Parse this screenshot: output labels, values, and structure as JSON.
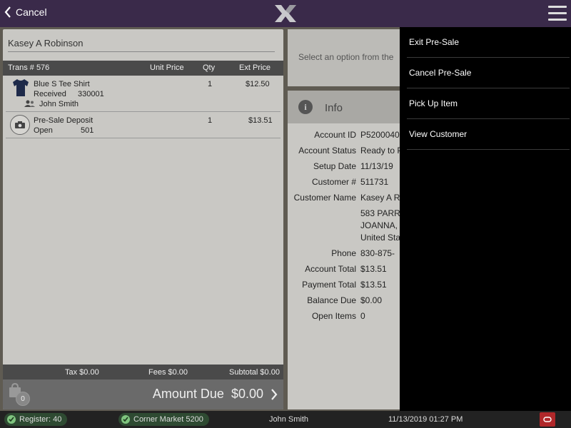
{
  "header": {
    "cancel_label": "Cancel"
  },
  "customer": {
    "name": "Kasey A Robinson"
  },
  "transaction": {
    "trans_label": "Trans # 576",
    "col_unit_price": "Unit Price",
    "col_qty": "Qty",
    "col_ext_price": "Ext Price",
    "items": [
      {
        "name": "Blue S Tee Shirt",
        "status": "Received",
        "code": "330001",
        "assignee": "John Smith",
        "qty": "1",
        "ext_price": "$12.50",
        "icon": "tshirt-icon"
      },
      {
        "name": "Pre-Sale Deposit",
        "status": "Open",
        "code": "501",
        "qty": "1",
        "ext_price": "$13.51",
        "icon": "camera-icon"
      }
    ],
    "tax": "Tax $0.00",
    "fees": "Fees $0.00",
    "subtotal": "Subtotal $0.00",
    "bag_count": "0",
    "amount_due_label": "Amount Due",
    "amount_due_value": "$0.00"
  },
  "prompt": {
    "text": "Select an option from the"
  },
  "info": {
    "title": "Info",
    "rows": [
      {
        "label": "Account ID",
        "value": "P5200040"
      },
      {
        "label": "Account Status",
        "value": "Ready to P"
      },
      {
        "label": "Setup Date",
        "value": "11/13/19"
      },
      {
        "label": "Customer #",
        "value": "511731"
      },
      {
        "label": "Customer Name",
        "value": "Kasey A R"
      },
      {
        "label": "",
        "value": "583 PARR"
      },
      {
        "label": "",
        "value": "JOANNA,"
      },
      {
        "label": "",
        "value": "United Sta"
      },
      {
        "label": "Phone",
        "value": "830-875-"
      },
      {
        "label": "Account Total",
        "value": "$13.51"
      },
      {
        "label": "Payment Total",
        "value": "$13.51"
      },
      {
        "label": "Balance Due",
        "value": "$0.00"
      },
      {
        "label": "Open Items",
        "value": "0"
      }
    ]
  },
  "menu": {
    "items": [
      {
        "label": "Exit Pre-Sale"
      },
      {
        "label": "Cancel Pre-Sale"
      },
      {
        "label": "Pick Up Item"
      },
      {
        "label": "View Customer"
      }
    ]
  },
  "status": {
    "register": "Register: 40",
    "store": "Corner Market 5200",
    "user": "John Smith",
    "datetime": "11/13/2019 01:27 PM"
  },
  "colors": {
    "topbar": "#3a2a4a",
    "menu_bg": "#000000",
    "alert": "#b0282a",
    "status_ok": "#7fc47f"
  }
}
